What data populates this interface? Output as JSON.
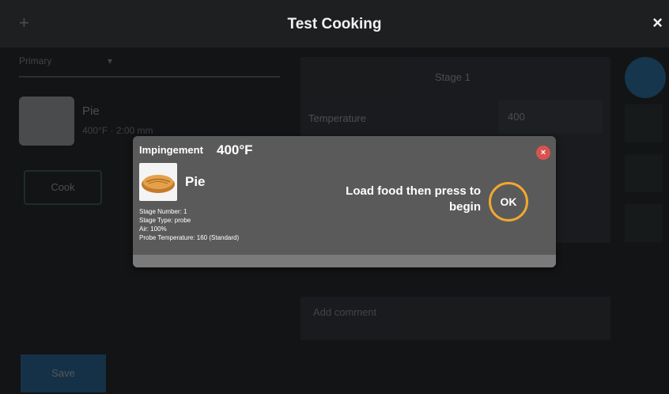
{
  "header": {
    "title": "Test Cooking",
    "close_icon": "×",
    "add_icon": "+"
  },
  "left": {
    "dropdown_value": "Primary",
    "recipe_name": "Pie",
    "recipe_meta": "400°F   ·   2:00 mm",
    "cook_label": "Cook",
    "save_label": "Save"
  },
  "right": {
    "stage_title": "Stage 1",
    "temperature_label": "Temperature",
    "temperature_value": "400",
    "comment_placeholder": "Add comment"
  },
  "modal": {
    "mode": "Impingement",
    "temperature": "400°F",
    "recipe_name": "Pie",
    "stage_number": "Stage Number: 1",
    "stage_type": "Stage Type: probe",
    "air": "Air: 100%",
    "probe_temperature": "Probe Temperature: 160 (Standard)",
    "message": "Load food then press to begin",
    "ok_label": "OK",
    "close_label": "×"
  },
  "colors": {
    "accent": "#1d8fd8",
    "ok_ring": "#f0a830",
    "close_red": "#d9524f"
  }
}
